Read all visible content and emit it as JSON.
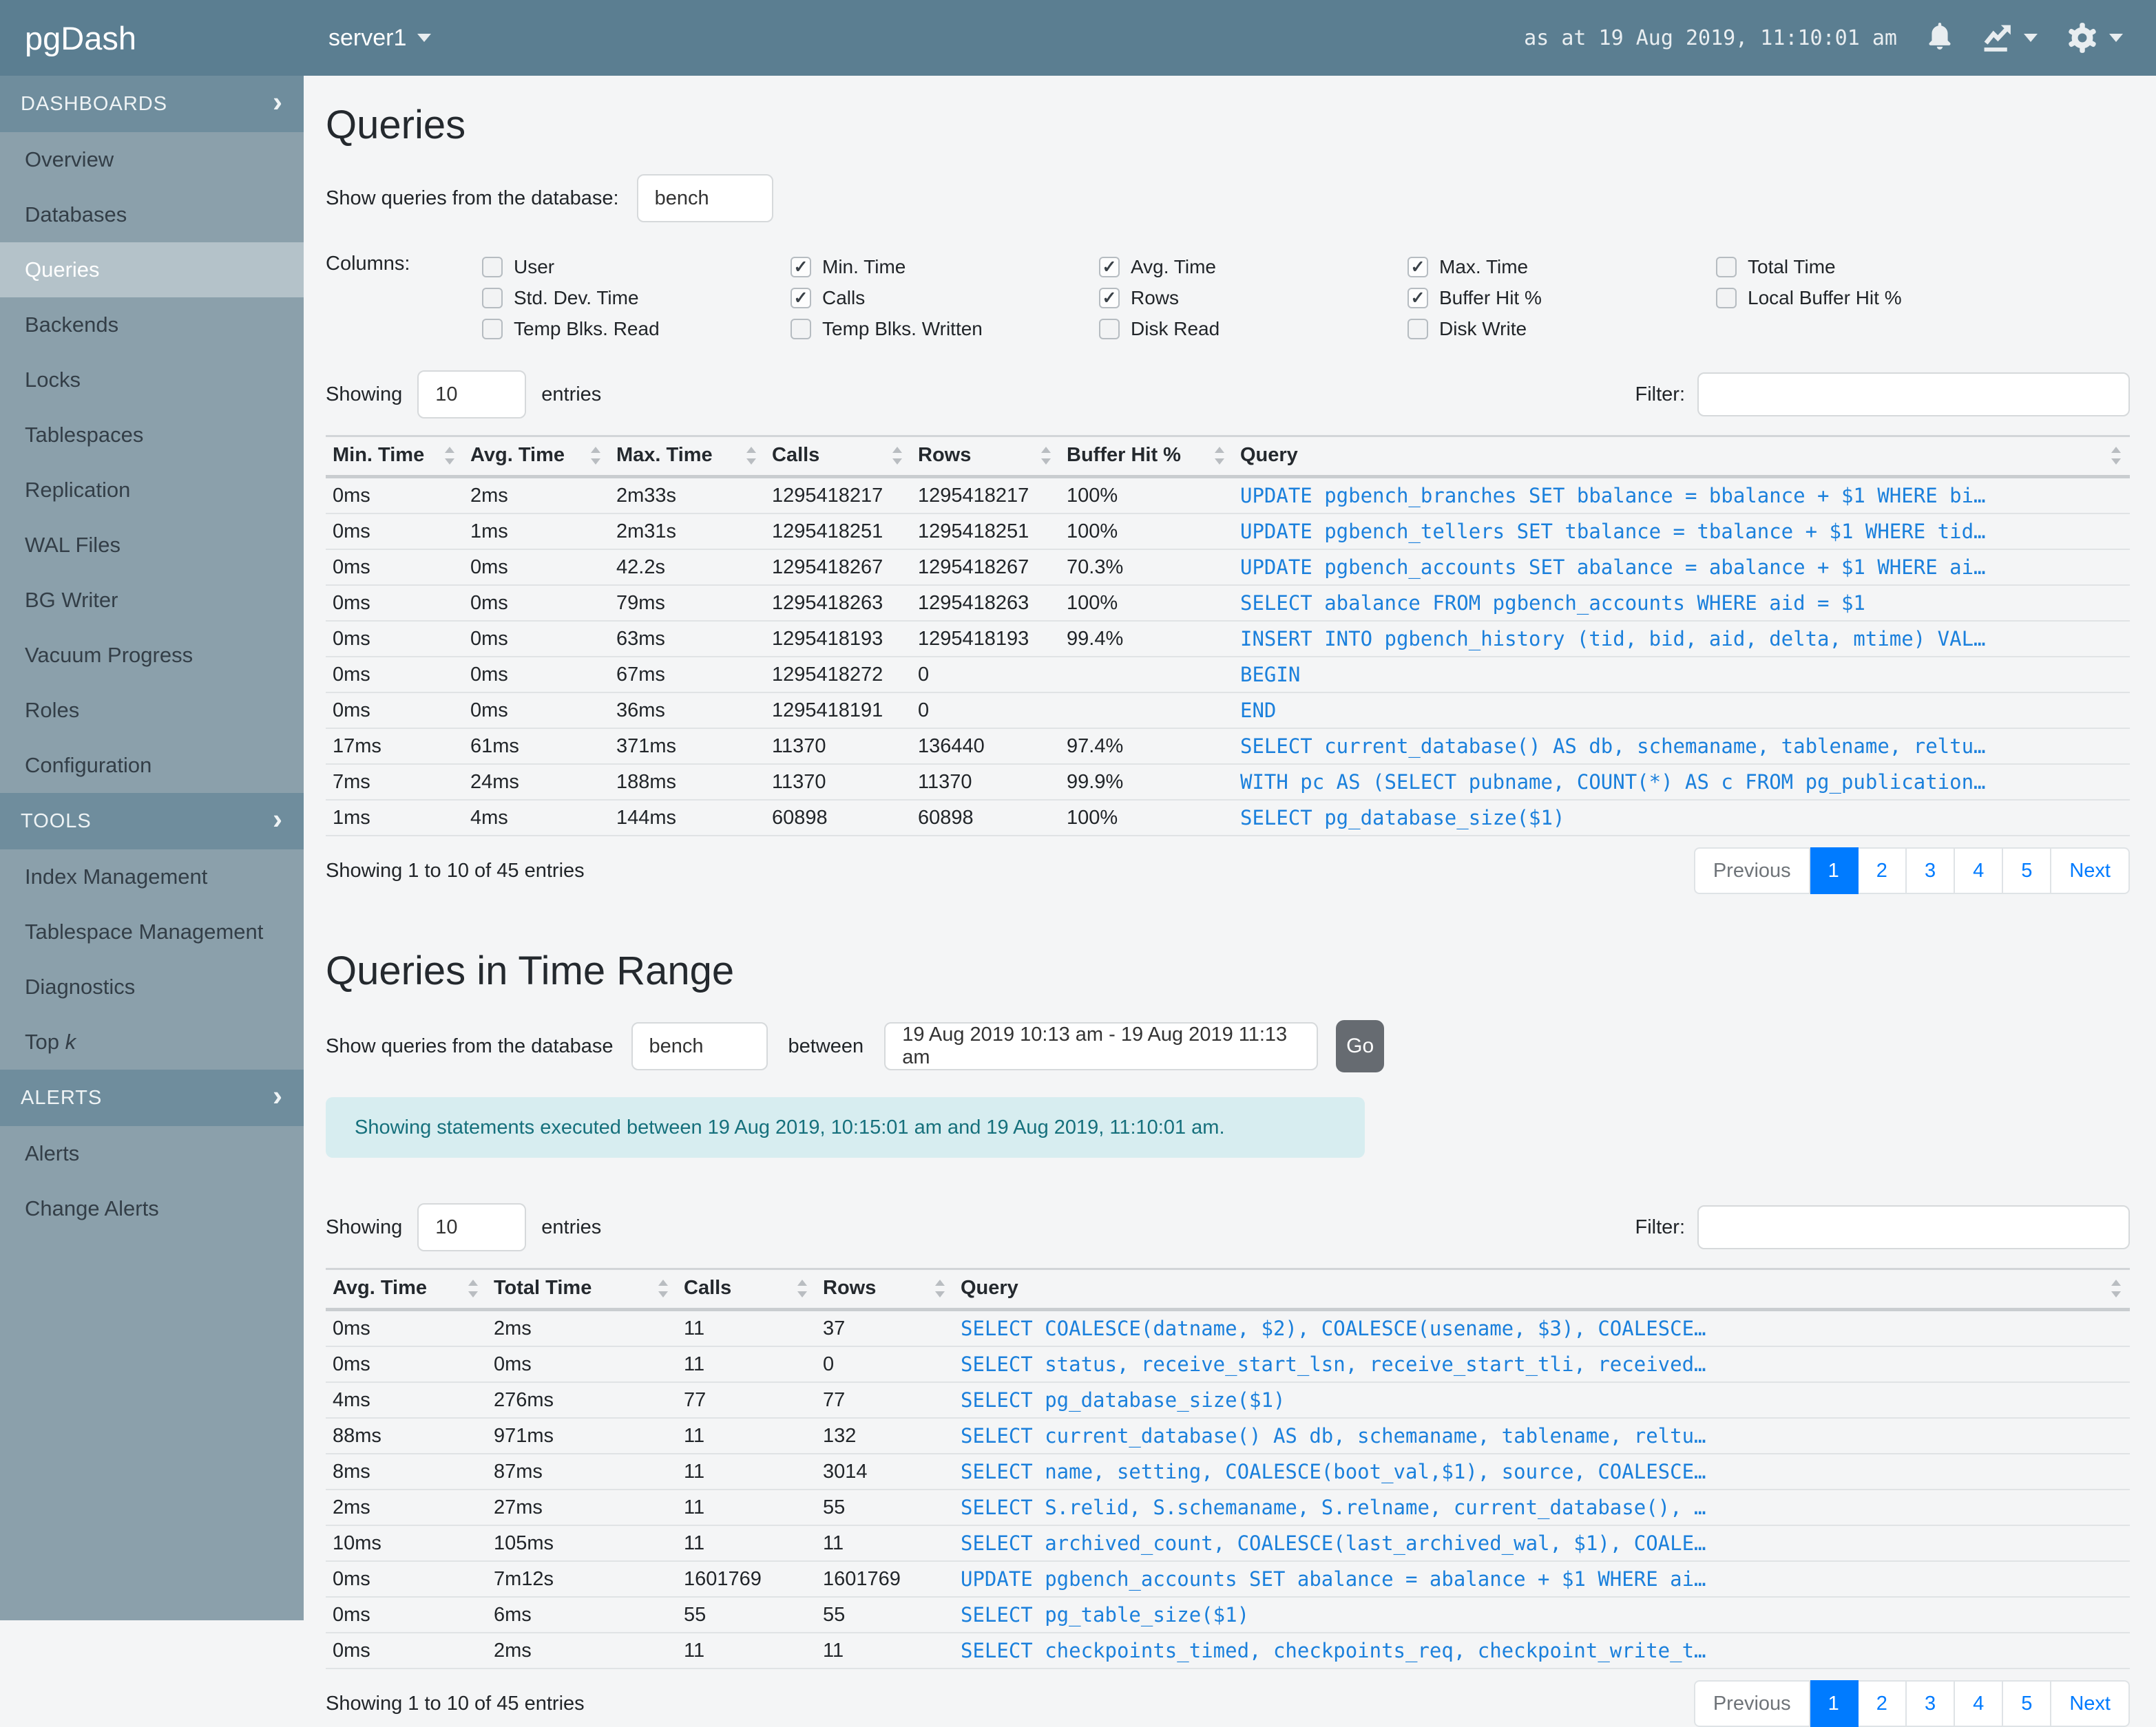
{
  "colors": {
    "navbar_bg": "#5b7e91",
    "sidebar_bg": "#8ba0ab",
    "sidebar_active_bg": "#b4c2c9",
    "query_link_blue": "#1b80dc",
    "pagination_active_blue": "#007bff",
    "notice_bg": "#d7edf0",
    "notice_text": "#16707c",
    "go_button_bg": "#666b71"
  },
  "navbar": {
    "brand": "pgDash",
    "server": "server1",
    "timestamp": "as at 19 Aug 2019, 11:10:01 am",
    "icons": [
      "bell-icon",
      "chart-line-icon",
      "gear-icon"
    ]
  },
  "sidebar": {
    "sections": [
      {
        "label": "DASHBOARDS",
        "items": [
          {
            "label": "Overview"
          },
          {
            "label": "Databases"
          },
          {
            "label": "Queries",
            "active": true
          },
          {
            "label": "Backends"
          },
          {
            "label": "Locks"
          },
          {
            "label": "Tablespaces"
          },
          {
            "label": "Replication"
          },
          {
            "label": "WAL Files"
          },
          {
            "label": "BG Writer"
          },
          {
            "label": "Vacuum Progress"
          },
          {
            "label": "Roles"
          },
          {
            "label": "Configuration"
          }
        ]
      },
      {
        "label": "TOOLS",
        "items": [
          {
            "label": "Index Management"
          },
          {
            "label": "Tablespace Management"
          },
          {
            "label": "Diagnostics"
          },
          {
            "label": "Top k"
          }
        ]
      },
      {
        "label": "ALERTS",
        "items": [
          {
            "label": "Alerts"
          },
          {
            "label": "Change Alerts"
          }
        ]
      }
    ]
  },
  "queries_section": {
    "title": "Queries",
    "db_label": "Show queries from the database:",
    "db_value": "bench",
    "columns_label": "Columns:",
    "column_groups": [
      [
        {
          "label": "User",
          "checked": false
        },
        {
          "label": "Std. Dev. Time",
          "checked": false
        },
        {
          "label": "Temp Blks. Read",
          "checked": false
        }
      ],
      [
        {
          "label": "Min. Time",
          "checked": true
        },
        {
          "label": "Calls",
          "checked": true
        },
        {
          "label": "Temp Blks. Written",
          "checked": false
        }
      ],
      [
        {
          "label": "Avg. Time",
          "checked": true
        },
        {
          "label": "Rows",
          "checked": true
        },
        {
          "label": "Disk Read",
          "checked": false
        }
      ],
      [
        {
          "label": "Max. Time",
          "checked": true
        },
        {
          "label": "Buffer Hit %",
          "checked": true
        },
        {
          "label": "Disk Write",
          "checked": false
        }
      ],
      [
        {
          "label": "Total Time",
          "checked": false
        },
        {
          "label": "Local Buffer Hit %",
          "checked": false
        }
      ]
    ],
    "showing_label": "Showing",
    "page_size": "10",
    "entries_label": "entries",
    "filter_label": "Filter:",
    "filter_value": "",
    "table": {
      "headers": [
        "Min. Time",
        "Avg. Time",
        "Max. Time",
        "Calls",
        "Rows",
        "Buffer Hit %",
        "Query"
      ],
      "rows": [
        [
          "0ms",
          "2ms",
          "2m33s",
          "1295418217",
          "1295418217",
          "100%",
          "UPDATE pgbench_branches SET bbalance = bbalance + $1 WHERE bi…"
        ],
        [
          "0ms",
          "1ms",
          "2m31s",
          "1295418251",
          "1295418251",
          "100%",
          "UPDATE pgbench_tellers SET tbalance = tbalance + $1 WHERE tid…"
        ],
        [
          "0ms",
          "0ms",
          "42.2s",
          "1295418267",
          "1295418267",
          "70.3%",
          "UPDATE pgbench_accounts SET abalance = abalance + $1 WHERE ai…"
        ],
        [
          "0ms",
          "0ms",
          "79ms",
          "1295418263",
          "1295418263",
          "100%",
          "SELECT abalance FROM pgbench_accounts WHERE aid = $1"
        ],
        [
          "0ms",
          "0ms",
          "63ms",
          "1295418193",
          "1295418193",
          "99.4%",
          "INSERT INTO pgbench_history (tid, bid, aid, delta, mtime) VAL…"
        ],
        [
          "0ms",
          "0ms",
          "67ms",
          "1295418272",
          "0",
          "",
          "BEGIN"
        ],
        [
          "0ms",
          "0ms",
          "36ms",
          "1295418191",
          "0",
          "",
          "END"
        ],
        [
          "17ms",
          "61ms",
          "371ms",
          "11370",
          "136440",
          "97.4%",
          "SELECT current_database() AS db, schemaname, tablename, reltu…"
        ],
        [
          "7ms",
          "24ms",
          "188ms",
          "11370",
          "11370",
          "99.9%",
          "WITH pc AS (SELECT pubname, COUNT(*) AS c FROM pg_publication…"
        ],
        [
          "1ms",
          "4ms",
          "144ms",
          "60898",
          "60898",
          "100%",
          "SELECT pg_database_size($1)"
        ]
      ]
    },
    "summary": "Showing 1 to 10 of 45 entries",
    "pagination": {
      "prev": "Previous",
      "pages": [
        "1",
        "2",
        "3",
        "4",
        "5"
      ],
      "next": "Next",
      "active": "1"
    }
  },
  "time_range_section": {
    "title": "Queries in Time Range",
    "db_label": "Show queries from the database",
    "db_value": "bench",
    "between_label": "between",
    "range_value": "19 Aug 2019 10:13 am - 19 Aug 2019 11:13 am",
    "go_label": "Go",
    "notice": "Showing statements executed between 19 Aug 2019, 10:15:01 am and 19 Aug 2019, 11:10:01 am.",
    "showing_label": "Showing",
    "page_size": "10",
    "entries_label": "entries",
    "filter_label": "Filter:",
    "filter_value": "",
    "table": {
      "headers": [
        "Avg. Time",
        "Total Time",
        "Calls",
        "Rows",
        "Query"
      ],
      "rows": [
        [
          "0ms",
          "2ms",
          "11",
          "37",
          "SELECT COALESCE(datname, $2), COALESCE(usename, $3), COALESCE…"
        ],
        [
          "0ms",
          "0ms",
          "11",
          "0",
          "SELECT status, receive_start_lsn, receive_start_tli, received…"
        ],
        [
          "4ms",
          "276ms",
          "77",
          "77",
          "SELECT pg_database_size($1)"
        ],
        [
          "88ms",
          "971ms",
          "11",
          "132",
          "SELECT current_database() AS db, schemaname, tablename, reltu…"
        ],
        [
          "8ms",
          "87ms",
          "11",
          "3014",
          "SELECT name, setting, COALESCE(boot_val,$1), source, COALESCE…"
        ],
        [
          "2ms",
          "27ms",
          "11",
          "55",
          "SELECT S.relid, S.schemaname, S.relname, current_database(), …"
        ],
        [
          "10ms",
          "105ms",
          "11",
          "11",
          "SELECT archived_count, COALESCE(last_archived_wal, $1), COALE…"
        ],
        [
          "0ms",
          "7m12s",
          "1601769",
          "1601769",
          "UPDATE pgbench_accounts SET abalance = abalance + $1 WHERE ai…"
        ],
        [
          "0ms",
          "6ms",
          "55",
          "55",
          "SELECT pg_table_size($1)"
        ],
        [
          "0ms",
          "2ms",
          "11",
          "11",
          "SELECT checkpoints_timed, checkpoints_req, checkpoint_write_t…"
        ]
      ]
    },
    "summary": "Showing 1 to 10 of 45 entries",
    "pagination": {
      "prev": "Previous",
      "pages": [
        "1",
        "2",
        "3",
        "4",
        "5"
      ],
      "next": "Next",
      "active": "1"
    }
  }
}
